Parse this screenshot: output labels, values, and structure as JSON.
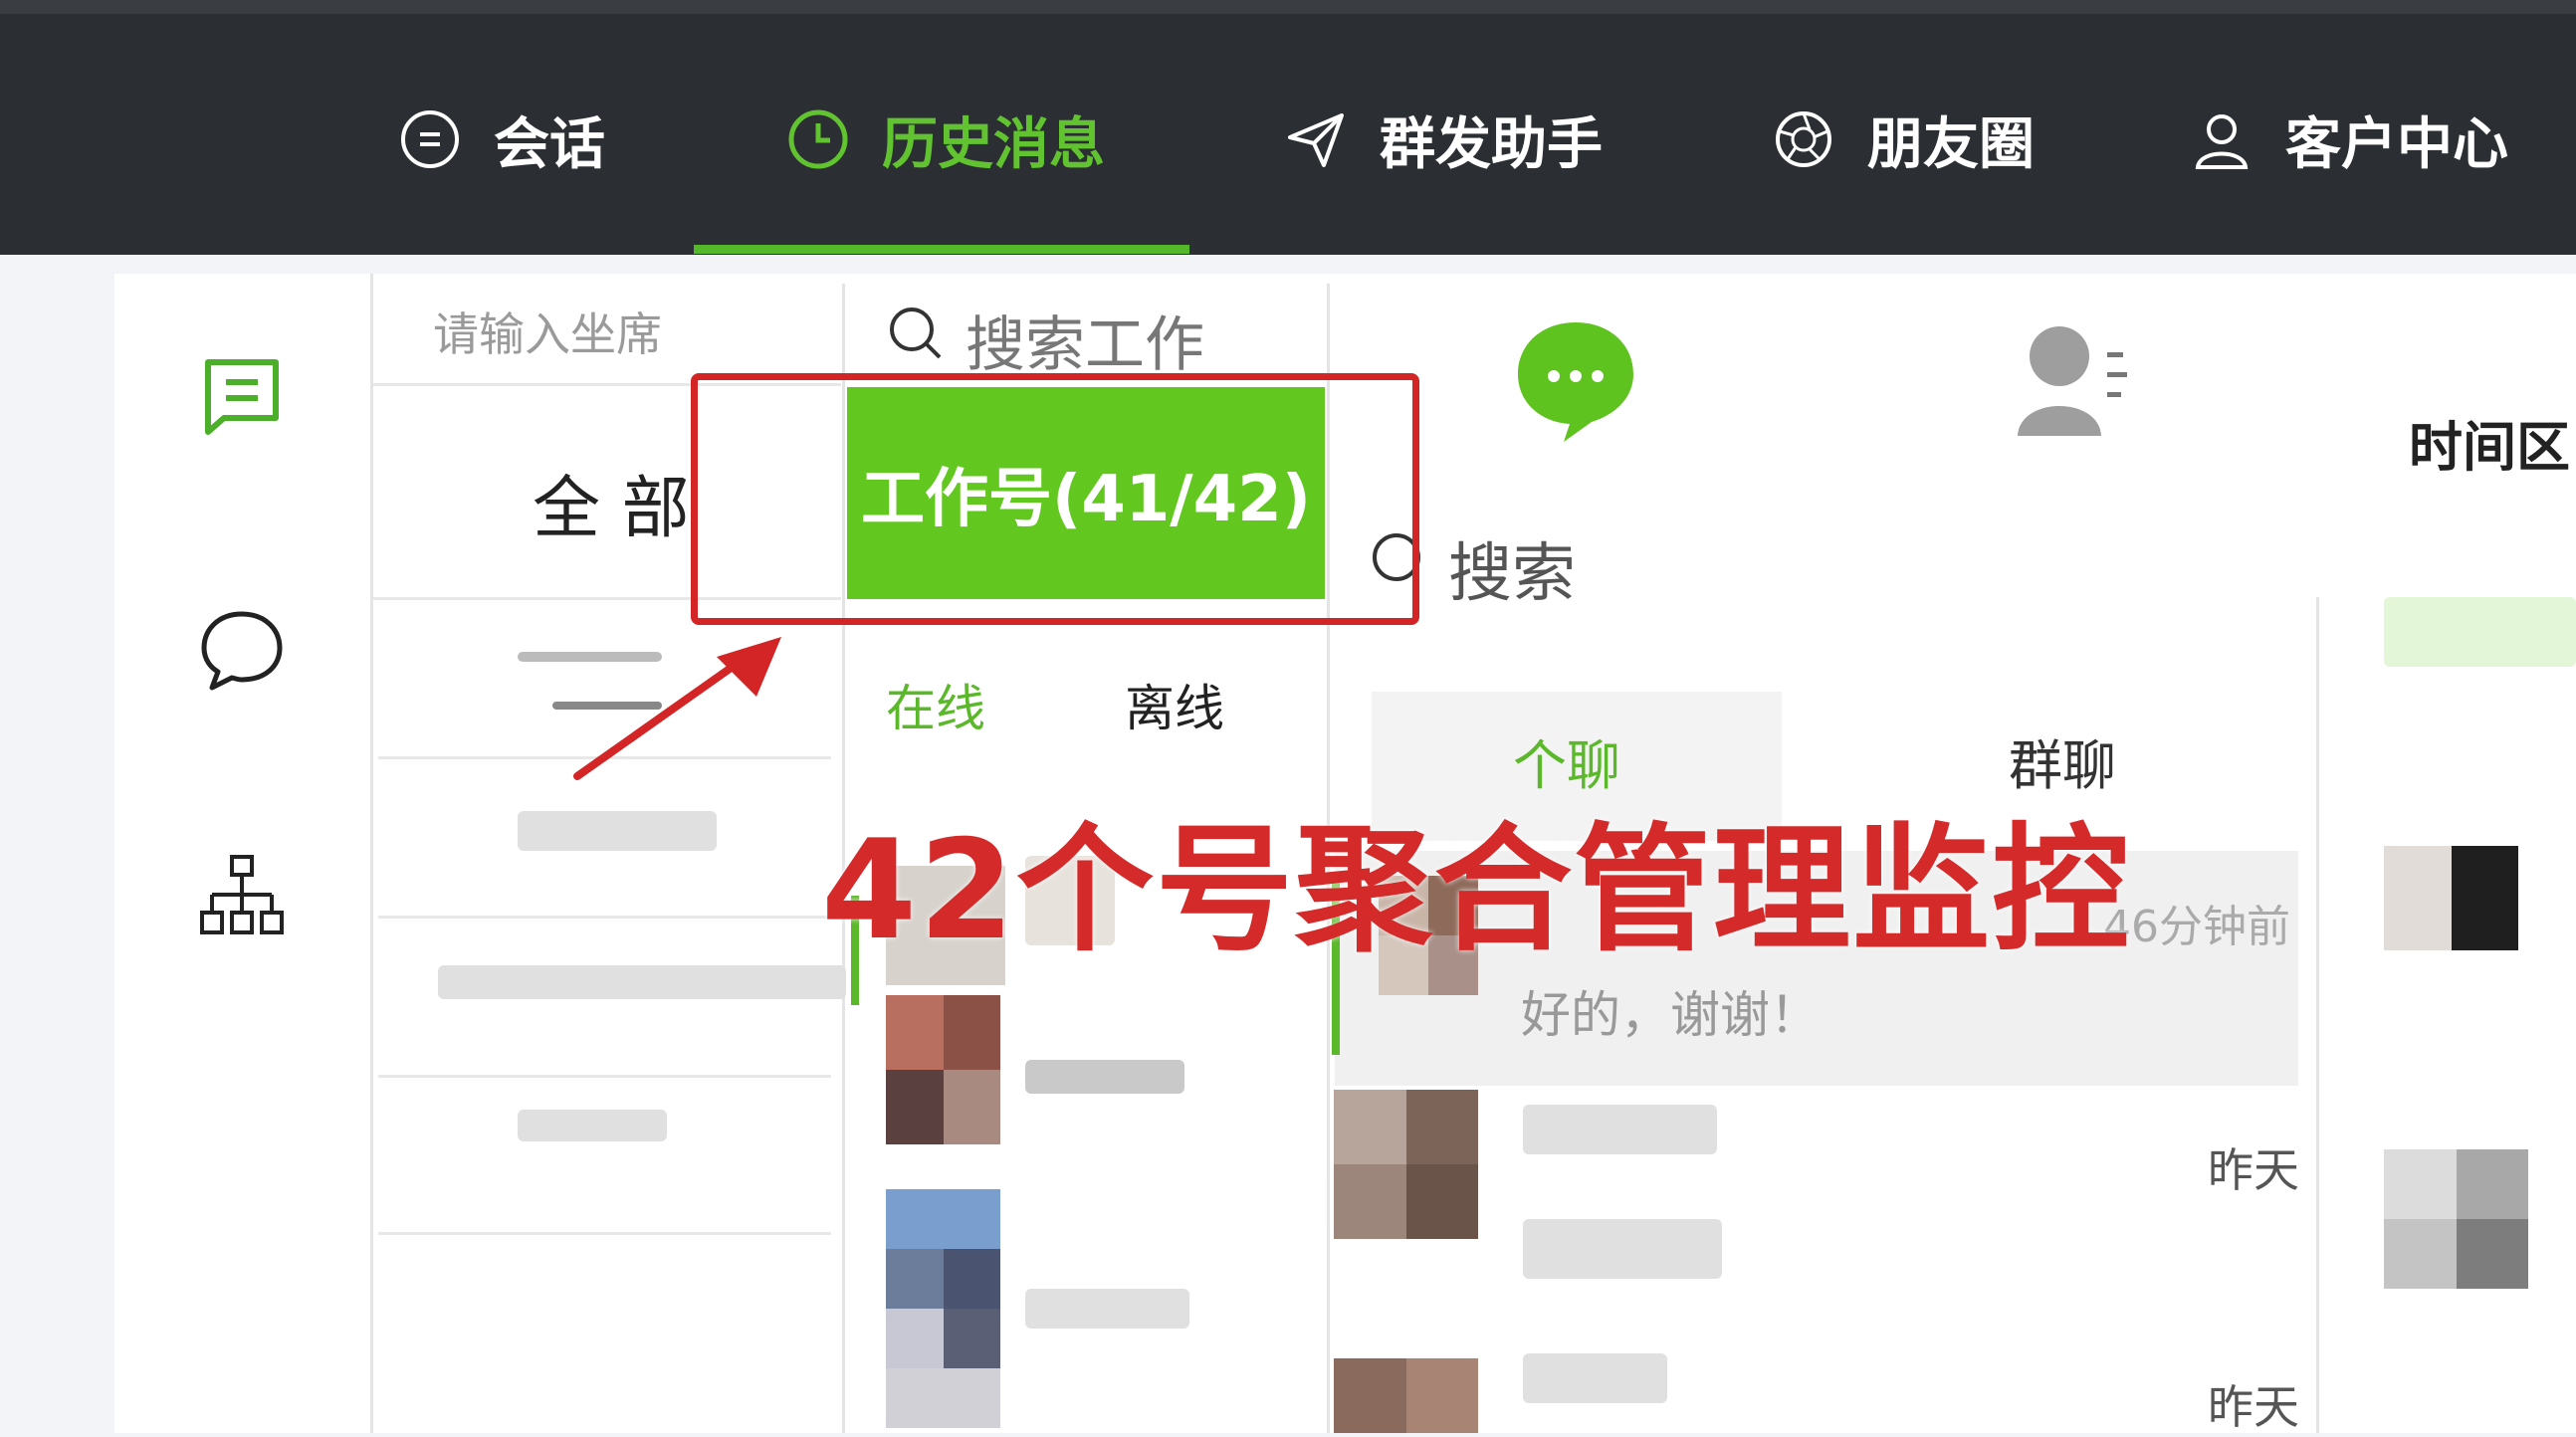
{
  "nav": {
    "items": [
      {
        "label": "会话",
        "icon": "chat-bubble-icon",
        "active": false
      },
      {
        "label": "历史消息",
        "icon": "clock-icon",
        "active": true
      },
      {
        "label": "群发助手",
        "icon": "paper-plane-icon",
        "active": false
      },
      {
        "label": "朋友圈",
        "icon": "aperture-icon",
        "active": false
      },
      {
        "label": "客户中心",
        "icon": "user-icon",
        "active": false
      }
    ]
  },
  "seats": {
    "search_placeholder": "请输入坐席",
    "all_label": "全 部"
  },
  "accounts": {
    "search_placeholder": "搜索工作",
    "work_button_label": "工作号(41/42)",
    "online_tab": "在线",
    "offline_tab": "离线"
  },
  "chats": {
    "search_placeholder": "搜索",
    "tab_private": "个聊",
    "tab_group": "群聊",
    "rows": [
      {
        "time": "46分钟前",
        "preview": "好的，谢谢！"
      },
      {
        "time": "昨天",
        "preview": ""
      },
      {
        "time": "昨天",
        "preview": ""
      }
    ]
  },
  "right": {
    "title": "时间区"
  },
  "annotation": {
    "text": "42个号聚合管理监控"
  },
  "colors": {
    "accent": "#62c71f",
    "topbar": "#2b2e33",
    "annotation_red": "#d32525"
  }
}
